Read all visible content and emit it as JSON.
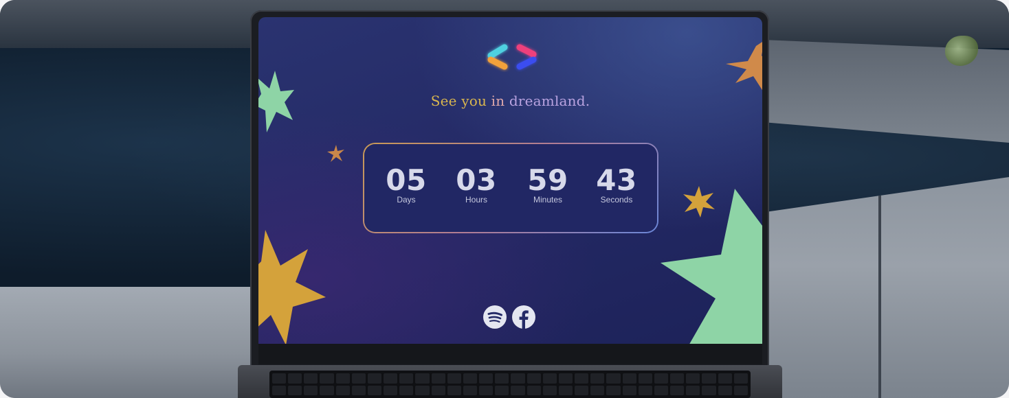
{
  "page": {
    "tagline": {
      "part1": "See you",
      "part2": "in",
      "part3": "dreamland."
    },
    "countdown": [
      {
        "value": "05",
        "label": "Days"
      },
      {
        "value": "03",
        "label": "Hours"
      },
      {
        "value": "59",
        "label": "Minutes"
      },
      {
        "value": "43",
        "label": "Seconds"
      }
    ],
    "social": [
      {
        "icon": "spotify-icon"
      },
      {
        "icon": "facebook-icon"
      }
    ],
    "colors": {
      "screen_bg": "#242a66",
      "star_green": "#8ed4a6",
      "star_gold": "#d4a23b",
      "star_orange": "#d08a4a",
      "logo_cyan": "#4fd0e0",
      "logo_orange": "#f2a13a",
      "logo_pink": "#ee3f7c",
      "logo_blue": "#3b4df0"
    }
  }
}
